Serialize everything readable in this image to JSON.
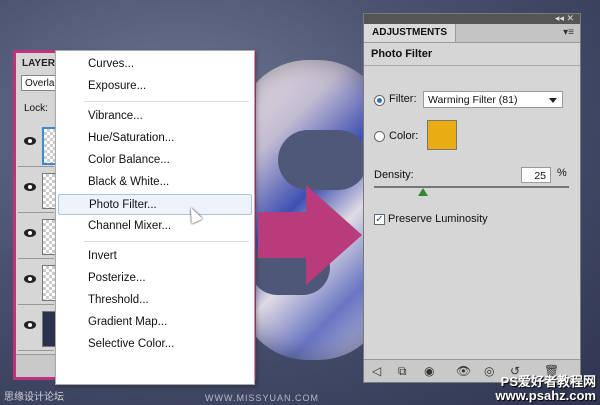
{
  "layers_panel": {
    "tab_label": "LAYER",
    "blend_mode": "Overla",
    "lock_label": "Lock:"
  },
  "adjustment_menu": {
    "items": [
      "Curves...",
      "Exposure...",
      "Vibrance...",
      "Hue/Saturation...",
      "Color Balance...",
      "Black & White...",
      "Photo Filter...",
      "Channel Mixer...",
      "Invert",
      "Posterize...",
      "Threshold...",
      "Gradient Map...",
      "Selective Color..."
    ],
    "highlighted": "Photo Filter..."
  },
  "adjustments_panel": {
    "tab_label": "ADJUSTMENTS",
    "header": "Photo Filter",
    "filter_label": "Filter:",
    "filter_value": "Warming Filter (81)",
    "color_label": "Color:",
    "color_swatch": "#e9ad13",
    "density_label": "Density:",
    "density_value": "25",
    "density_unit": "%",
    "preserve_label": "Preserve Luminosity",
    "preserve_checked": true,
    "filter_mode": "filter"
  },
  "watermarks": {
    "left": "思缘设计论坛",
    "middle": "WWW.MISSYUAN.COM",
    "right_line1": "PS爱好者教程网",
    "right_line2": "www.psahz.com"
  },
  "colors": {
    "accent_pink": "#c0327a",
    "arrow": "#b83b7b"
  }
}
